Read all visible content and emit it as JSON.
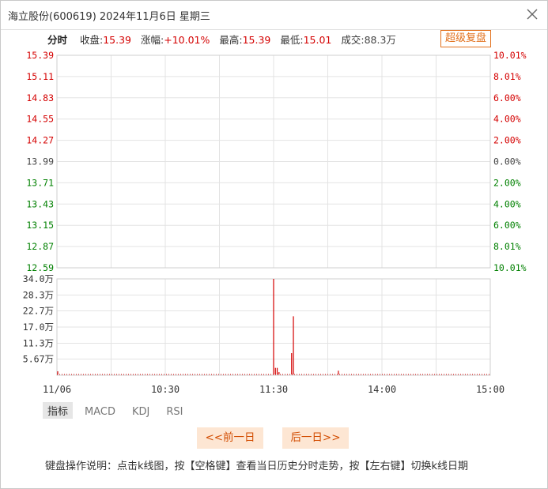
{
  "window": {
    "title": "海立股份(600619)  2024年11月6日  星期三"
  },
  "infobar": {
    "mode_label": "分时",
    "close_label": "收盘:",
    "close_value": "15.39",
    "change_label": "涨幅:",
    "change_value": "+10.01%",
    "high_label": "最高:",
    "high_value": "15.39",
    "low_label": "最低:",
    "low_value": "15.01",
    "volume_label": "成交:",
    "volume_value": "88.3万",
    "fuquan_button": "超级复盘"
  },
  "colors": {
    "up": "#d40000",
    "down": "#008000",
    "neutral": "#444444",
    "accent": "#e2711d",
    "volume_bar": "#d40000"
  },
  "chart_data": {
    "type": "line",
    "title": "",
    "price_axis": {
      "ticks": [
        {
          "price": "15.39",
          "pct": "10.01%",
          "dir": "up"
        },
        {
          "price": "15.11",
          "pct": "8.01%",
          "dir": "up"
        },
        {
          "price": "14.83",
          "pct": "6.00%",
          "dir": "up"
        },
        {
          "price": "14.55",
          "pct": "4.00%",
          "dir": "up"
        },
        {
          "price": "14.27",
          "pct": "2.00%",
          "dir": "up"
        },
        {
          "price": "13.99",
          "pct": "0.00%",
          "dir": "flat"
        },
        {
          "price": "13.71",
          "pct": "2.00%",
          "dir": "down"
        },
        {
          "price": "13.43",
          "pct": "4.00%",
          "dir": "down"
        },
        {
          "price": "13.15",
          "pct": "6.00%",
          "dir": "down"
        },
        {
          "price": "12.87",
          "pct": "8.01%",
          "dir": "down"
        },
        {
          "price": "12.59",
          "pct": "10.01%",
          "dir": "down"
        }
      ],
      "ylim": [
        12.59,
        15.39
      ]
    },
    "volume_axis": {
      "ticks": [
        "34.0万",
        "28.3万",
        "22.7万",
        "17.0万",
        "11.3万",
        "5.67万"
      ],
      "ylim": [
        0,
        34.0
      ]
    },
    "x_ticks": [
      "11/06",
      "10:30",
      "11:30",
      "14:00",
      "15:00"
    ],
    "volume_series": {
      "name": "成交量",
      "points": [
        {
          "minute": 0,
          "value": 1.4
        },
        {
          "minute": 120,
          "value": 34.0
        },
        {
          "minute": 121,
          "value": 2.6
        },
        {
          "minute": 122,
          "value": 2.6
        },
        {
          "minute": 123,
          "value": 1.1
        },
        {
          "minute": 130,
          "value": 7.8
        },
        {
          "minute": 131,
          "value": 20.8
        },
        {
          "minute": 156,
          "value": 1.6
        }
      ],
      "total_minutes": 240
    }
  },
  "indicator_tabs": [
    {
      "label": "指标",
      "active": true
    },
    {
      "label": "MACD",
      "active": false
    },
    {
      "label": "KDJ",
      "active": false
    },
    {
      "label": "RSI",
      "active": false
    }
  ],
  "nav": {
    "prev": "<<前一日",
    "next": "后一日>>"
  },
  "help_text": "键盘操作说明：点击k线图，按【空格键】查看当日历史分时走势，按【左右键】切换k线日期"
}
